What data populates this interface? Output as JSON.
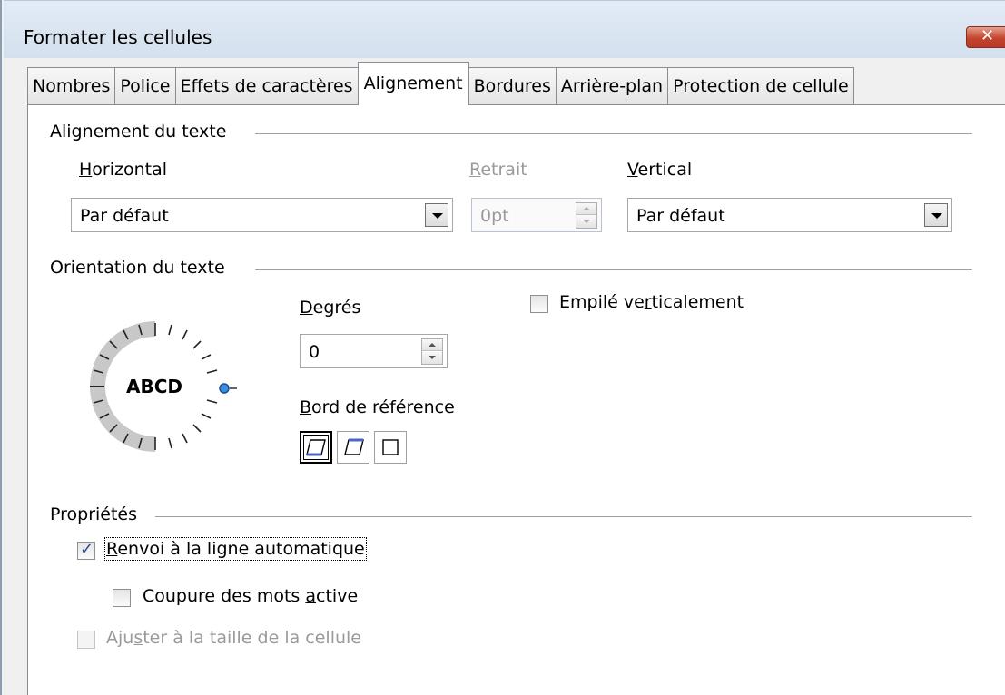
{
  "window": {
    "title": "Formater les cellules",
    "close_glyph": "✕"
  },
  "tabs": [
    {
      "label": "Nombres"
    },
    {
      "label": "Police"
    },
    {
      "label": "Effets de caractères"
    },
    {
      "label": "Alignement",
      "active": true
    },
    {
      "label": "Bordures"
    },
    {
      "label": "Arrière-plan"
    },
    {
      "label": "Protection de cellule"
    }
  ],
  "text_alignment": {
    "section_title": "Alignement du texte",
    "horizontal": {
      "label": "Horizontal",
      "mnemonic": "H",
      "label_rest": "orizontal",
      "value": "Par défaut"
    },
    "indent": {
      "label": "Retrait",
      "mnemonic": "R",
      "label_rest": "etrait",
      "value": "0pt",
      "disabled": true
    },
    "vertical": {
      "label": "Vertical",
      "mnemonic": "V",
      "label_rest": "ertical",
      "value": "Par défaut"
    }
  },
  "orientation": {
    "section_title": "Orientation du texte",
    "dial_text": "ABCD",
    "degrees": {
      "label_mn": "D",
      "label_rest": "egrés",
      "value": "0"
    },
    "reference_edge": {
      "label_mn": "B",
      "label_rest": "ord de référence",
      "selected_index": 0
    },
    "stacked": {
      "label_pre": "Empilé ve",
      "label_mn": "r",
      "label_post": "ticalement",
      "checked": false
    }
  },
  "properties": {
    "section_title": "Propriétés",
    "wrap": {
      "label_mn": "R",
      "label_rest": "envoi à la ligne automatique",
      "checked": true
    },
    "hyphenation": {
      "label_pre": "Coupure des mots ",
      "label_mn": "a",
      "label_post": "ctive",
      "checked": false
    },
    "shrink": {
      "label_pre": "Aju",
      "label_mn": "s",
      "label_post": "ter à la taille de la cellule",
      "checked": false,
      "disabled": true
    }
  },
  "colors": {
    "dial_pointer": "#3c8ee0",
    "edge_fill": "#4a64c8"
  }
}
